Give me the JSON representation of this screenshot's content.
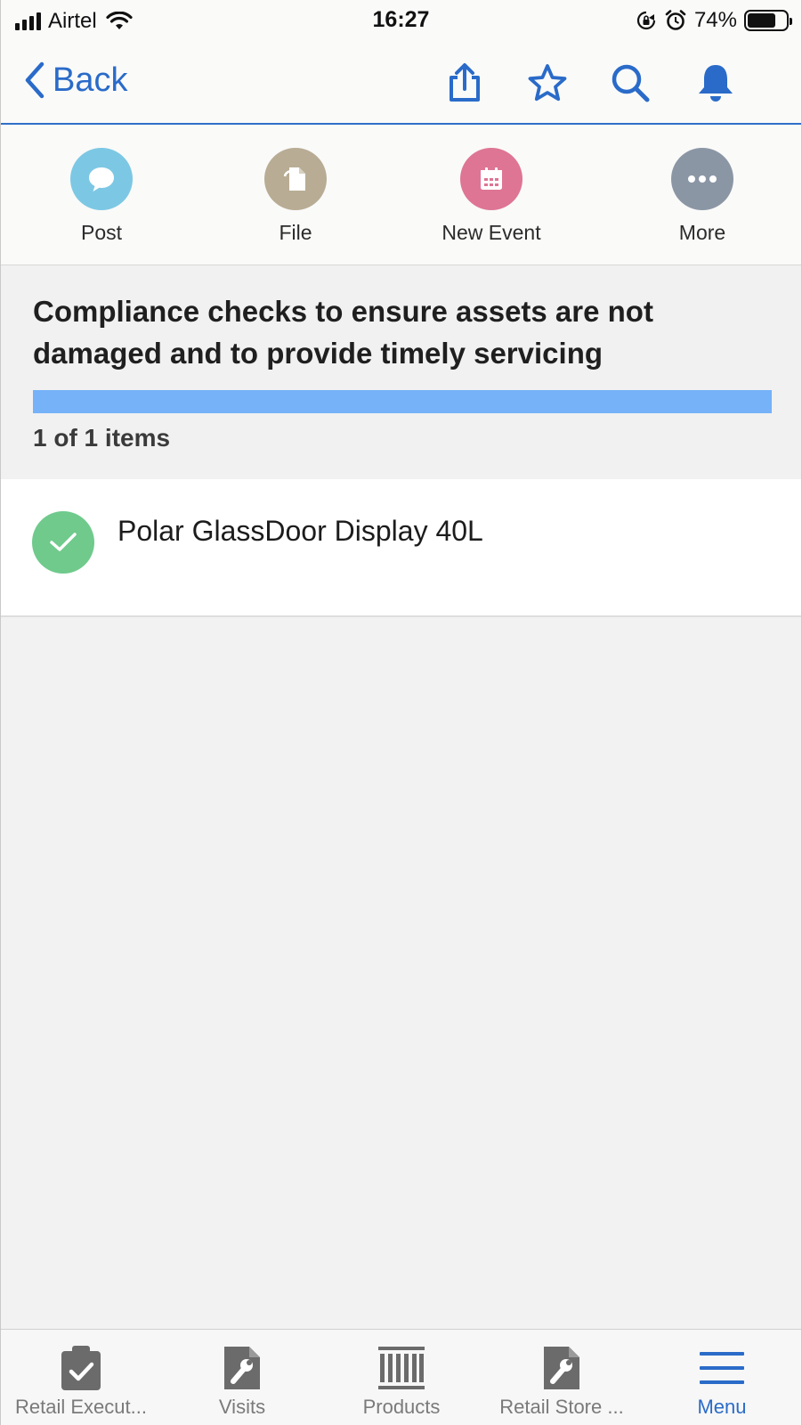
{
  "status_bar": {
    "carrier": "Airtel",
    "time": "16:27",
    "battery_percent": "74%",
    "battery_level": 0.74,
    "icons": [
      "signal-icon",
      "wifi-icon",
      "rotation-lock-icon",
      "alarm-icon",
      "battery-icon"
    ]
  },
  "nav": {
    "back_label": "Back",
    "icons": [
      "share-icon",
      "star-icon",
      "search-icon",
      "bell-icon"
    ],
    "accent_color": "#2a6bc9"
  },
  "actions": [
    {
      "label": "Post",
      "icon": "chat-bubble-icon",
      "color": "#7cc8e4"
    },
    {
      "label": "File",
      "icon": "file-icon",
      "color": "#b8ac94"
    },
    {
      "label": "New Event",
      "icon": "calendar-icon",
      "color": "#de7594"
    },
    {
      "label": "More",
      "icon": "more-icon",
      "color": "#8b96a5"
    }
  ],
  "header": {
    "title": "Compliance checks to ensure assets are not damaged and to provide timely servicing",
    "progress": 1.0,
    "progress_color": "#76b2f8",
    "count_label": "1 of 1 items"
  },
  "items": [
    {
      "label": "Polar GlassDoor Display 40L",
      "status_icon": "check-icon",
      "status_color": "#6fca8c"
    }
  ],
  "tabs": [
    {
      "label": "Retail Execut...",
      "icon": "clipboard-check-icon",
      "active": false
    },
    {
      "label": "Visits",
      "icon": "wrench-doc-icon",
      "active": false
    },
    {
      "label": "Products",
      "icon": "barcode-icon",
      "active": false
    },
    {
      "label": "Retail Store ...",
      "icon": "wrench-doc-icon",
      "active": false
    },
    {
      "label": "Menu",
      "icon": "menu-icon",
      "active": true
    }
  ]
}
